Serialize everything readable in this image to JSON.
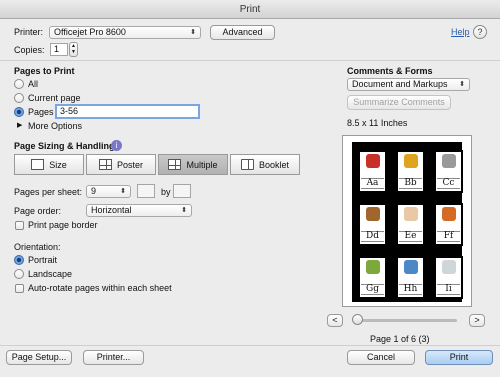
{
  "window": {
    "title": "Print"
  },
  "printer": {
    "label": "Printer:",
    "value": "Officejet Pro 8600",
    "advanced": "Advanced"
  },
  "help": "Help",
  "copies": {
    "label": "Copies:",
    "value": "1"
  },
  "pages_to_print": {
    "heading": "Pages to Print",
    "all": "All",
    "current": "Current page",
    "pages": "Pages",
    "pages_value": "3-56",
    "more_options": "More Options"
  },
  "comments": {
    "heading": "Comments & Forms",
    "value": "Document and Markups",
    "summarize": "Summarize Comments"
  },
  "paper": {
    "size": "8.5 x 11 Inches"
  },
  "sizing": {
    "heading": "Page Sizing & Handling",
    "buttons": [
      "Size",
      "Poster",
      "Multiple",
      "Booklet"
    ],
    "selected": "Multiple"
  },
  "multiple": {
    "pages_per_sheet_label": "Pages per sheet:",
    "pages_per_sheet_value": "9",
    "by": "by",
    "page_order_label": "Page order:",
    "page_order_value": "Horizontal",
    "print_border": "Print page border"
  },
  "orientation": {
    "heading": "Orientation:",
    "portrait": "Portrait",
    "landscape": "Landscape",
    "autorotate": "Auto-rotate pages within each sheet"
  },
  "preview": {
    "cards": [
      {
        "letters": "Aa",
        "color": "#c8302a"
      },
      {
        "letters": "Bb",
        "color": "#e0a31e"
      },
      {
        "letters": "Cc",
        "color": "#9a9a9a"
      },
      {
        "letters": "Dd",
        "color": "#a0662e"
      },
      {
        "letters": "Ee",
        "color": "#e9c9a4"
      },
      {
        "letters": "Ff",
        "color": "#d46a26"
      },
      {
        "letters": "Gg",
        "color": "#7ca83c"
      },
      {
        "letters": "Hh",
        "color": "#4d88c6"
      },
      {
        "letters": "Ii",
        "color": "#cfd6da"
      }
    ],
    "prev": "<",
    "next": ">",
    "page_status": "Page 1 of 6 (3)"
  },
  "footer": {
    "page_setup": "Page Setup...",
    "printer": "Printer...",
    "cancel": "Cancel",
    "print": "Print"
  }
}
